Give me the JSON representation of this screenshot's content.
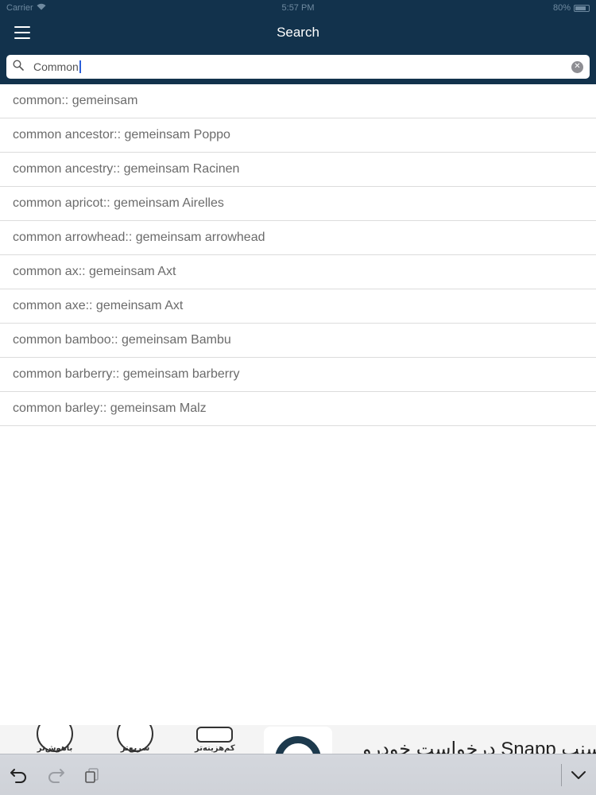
{
  "status_bar": {
    "carrier": "Carrier",
    "time": "5:57 PM",
    "battery": "80%"
  },
  "nav": {
    "title": "Search"
  },
  "search": {
    "value": "Common",
    "placeholder": ""
  },
  "results": [
    "common:: gemeinsam",
    "common ancestor:: gemeinsam Poppo",
    "common ancestry:: gemeinsam Racinen",
    "common apricot:: gemeinsam Airelles",
    "common arrowhead:: gemeinsam arrowhead",
    "common ax:: gemeinsam Axt",
    "common axe:: gemeinsam Axt",
    "common bamboo:: gemeinsam Bambu",
    "common barberry:: gemeinsam barberry",
    "common barley:: gemeinsam Malz"
  ],
  "ad": {
    "badges": [
      "باهوش‌تر",
      "سریع‌تر",
      "کم‌هزینه‌تر"
    ],
    "headline": "اسنپ Snapp درخواست خودرو"
  },
  "colors": {
    "header_bg": "#12324c",
    "caret": "#2b5fd9",
    "result_text": "#6b6b6b"
  }
}
